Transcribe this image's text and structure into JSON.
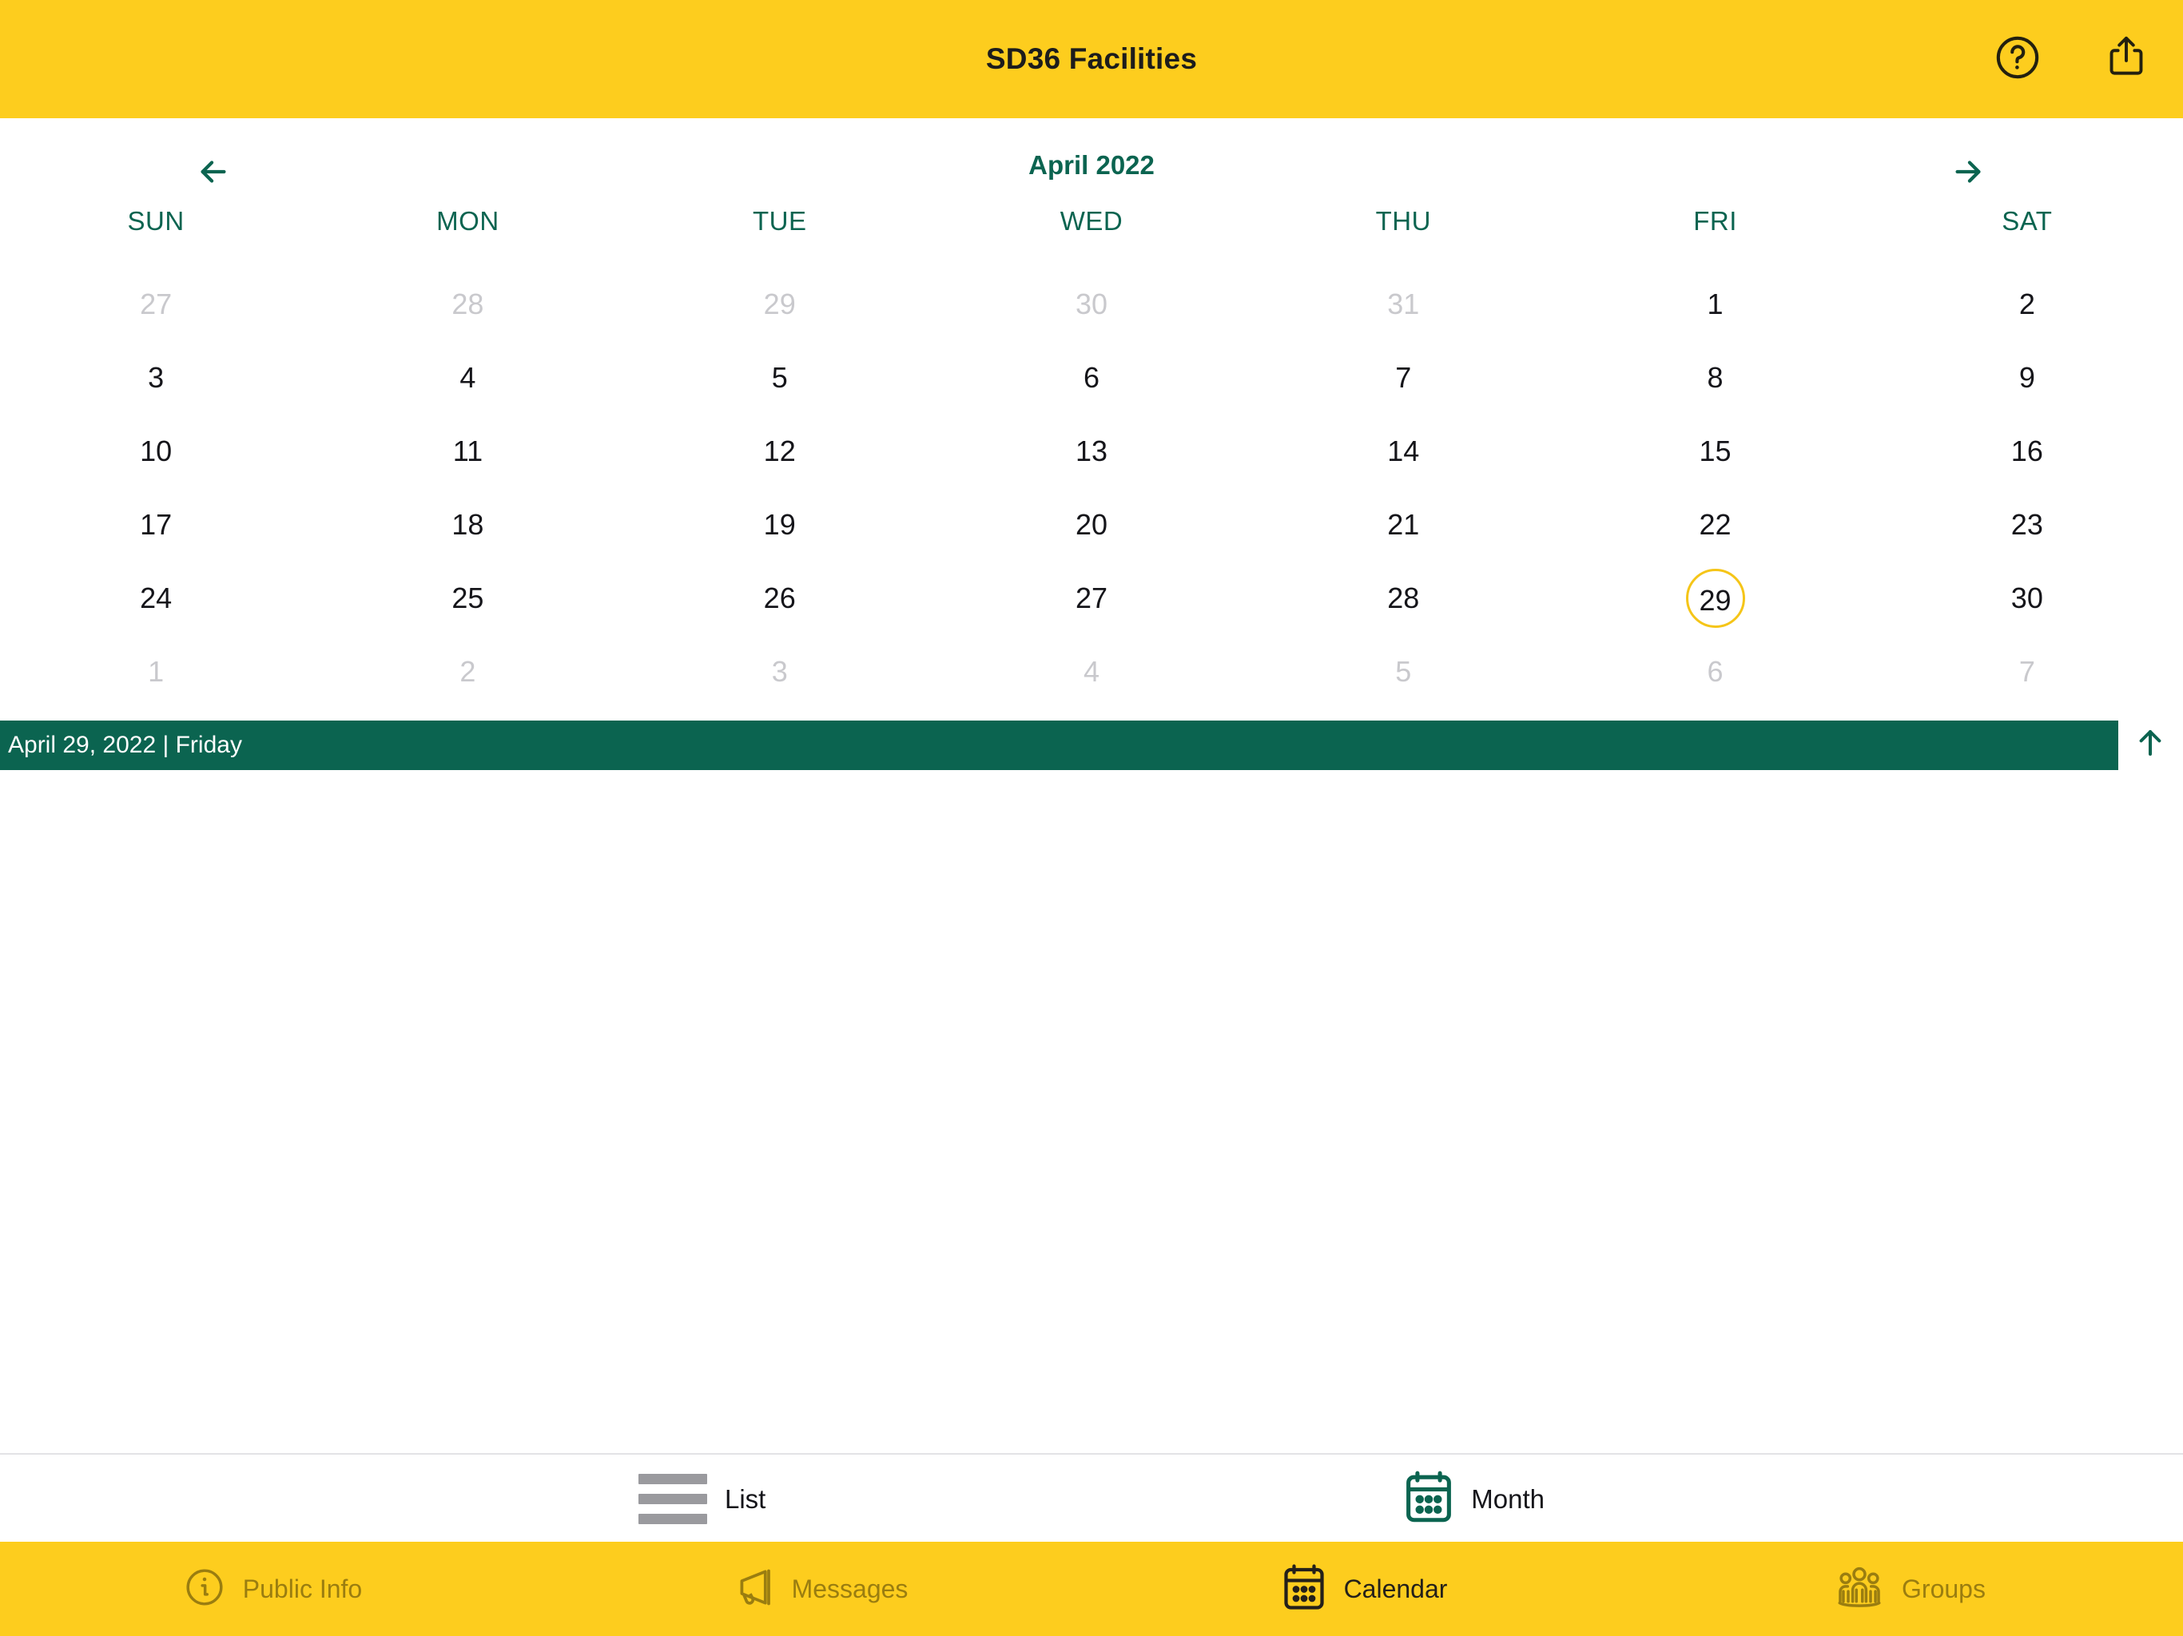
{
  "header": {
    "title": "SD36 Facilities",
    "help_icon": "question-circle-icon",
    "share_icon": "share-icon",
    "background_color": "#FDCD1E"
  },
  "calendar": {
    "month_label": "April 2022",
    "prev_icon": "arrow-left-icon",
    "next_icon": "arrow-right-icon",
    "accent_color": "#0B6450",
    "selected_outline_color": "#F5C518",
    "weekdays": [
      "SUN",
      "MON",
      "TUE",
      "WED",
      "THU",
      "FRI",
      "SAT"
    ],
    "weeks": [
      [
        {
          "day": "27",
          "muted": true,
          "selected": false
        },
        {
          "day": "28",
          "muted": true,
          "selected": false
        },
        {
          "day": "29",
          "muted": true,
          "selected": false
        },
        {
          "day": "30",
          "muted": true,
          "selected": false
        },
        {
          "day": "31",
          "muted": true,
          "selected": false
        },
        {
          "day": "1",
          "muted": false,
          "selected": false
        },
        {
          "day": "2",
          "muted": false,
          "selected": false
        }
      ],
      [
        {
          "day": "3",
          "muted": false,
          "selected": false
        },
        {
          "day": "4",
          "muted": false,
          "selected": false
        },
        {
          "day": "5",
          "muted": false,
          "selected": false
        },
        {
          "day": "6",
          "muted": false,
          "selected": false
        },
        {
          "day": "7",
          "muted": false,
          "selected": false
        },
        {
          "day": "8",
          "muted": false,
          "selected": false
        },
        {
          "day": "9",
          "muted": false,
          "selected": false
        }
      ],
      [
        {
          "day": "10",
          "muted": false,
          "selected": false
        },
        {
          "day": "11",
          "muted": false,
          "selected": false
        },
        {
          "day": "12",
          "muted": false,
          "selected": false
        },
        {
          "day": "13",
          "muted": false,
          "selected": false
        },
        {
          "day": "14",
          "muted": false,
          "selected": false
        },
        {
          "day": "15",
          "muted": false,
          "selected": false
        },
        {
          "day": "16",
          "muted": false,
          "selected": false
        }
      ],
      [
        {
          "day": "17",
          "muted": false,
          "selected": false
        },
        {
          "day": "18",
          "muted": false,
          "selected": false
        },
        {
          "day": "19",
          "muted": false,
          "selected": false
        },
        {
          "day": "20",
          "muted": false,
          "selected": false
        },
        {
          "day": "21",
          "muted": false,
          "selected": false
        },
        {
          "day": "22",
          "muted": false,
          "selected": false
        },
        {
          "day": "23",
          "muted": false,
          "selected": false
        }
      ],
      [
        {
          "day": "24",
          "muted": false,
          "selected": false
        },
        {
          "day": "25",
          "muted": false,
          "selected": false
        },
        {
          "day": "26",
          "muted": false,
          "selected": false
        },
        {
          "day": "27",
          "muted": false,
          "selected": false
        },
        {
          "day": "28",
          "muted": false,
          "selected": false
        },
        {
          "day": "29",
          "muted": false,
          "selected": true
        },
        {
          "day": "30",
          "muted": false,
          "selected": false
        }
      ],
      [
        {
          "day": "1",
          "muted": true,
          "selected": false
        },
        {
          "day": "2",
          "muted": true,
          "selected": false
        },
        {
          "day": "3",
          "muted": true,
          "selected": false
        },
        {
          "day": "4",
          "muted": true,
          "selected": false
        },
        {
          "day": "5",
          "muted": true,
          "selected": false
        },
        {
          "day": "6",
          "muted": true,
          "selected": false
        },
        {
          "day": "7",
          "muted": true,
          "selected": false
        }
      ]
    ]
  },
  "selected_day_banner": {
    "text": "April 29, 2022 | Friday",
    "background_color": "#0B6450",
    "collapse_icon": "arrow-up-icon"
  },
  "view_toggle": {
    "options": [
      {
        "label": "List",
        "icon": "list-lines-icon",
        "active": false
      },
      {
        "label": "Month",
        "icon": "calendar-icon",
        "active": true
      }
    ]
  },
  "tab_bar": {
    "background_color": "#FDCD1E",
    "inactive_color": "#9A7D10",
    "active_color": "#24201A",
    "items": [
      {
        "label": "Public Info",
        "icon": "info-circle-icon",
        "active": false
      },
      {
        "label": "Messages",
        "icon": "megaphone-icon",
        "active": false
      },
      {
        "label": "Calendar",
        "icon": "calendar-icon",
        "active": true
      },
      {
        "label": "Groups",
        "icon": "people-group-icon",
        "active": false
      }
    ]
  }
}
